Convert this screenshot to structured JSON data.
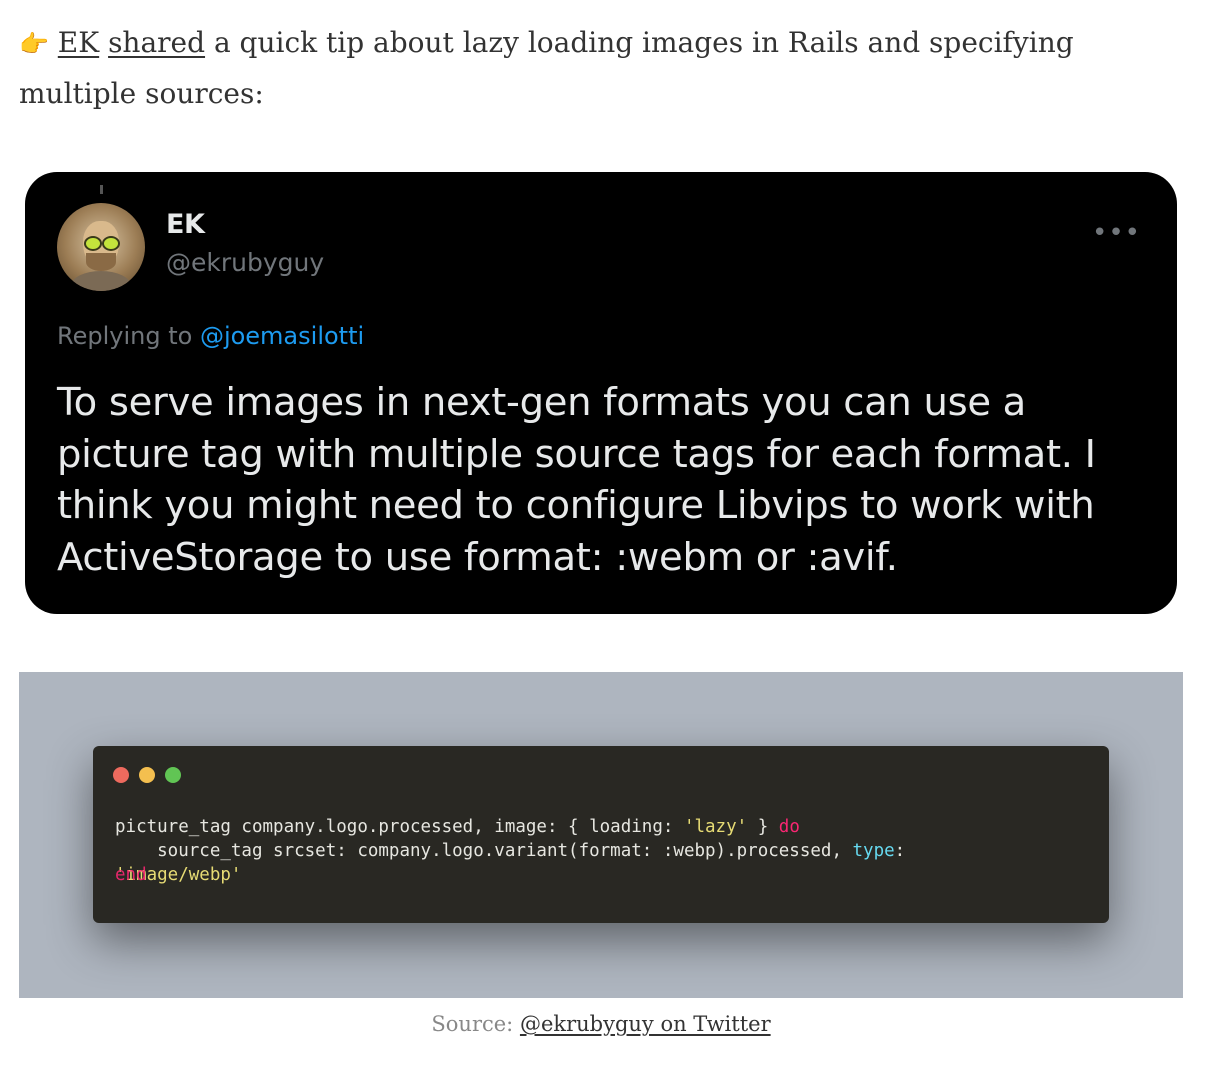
{
  "intro": {
    "emoji": "👉",
    "author_link": "EK",
    "shared_link": "shared",
    "text": " a quick tip about lazy loading images in Rails and specifying multiple sources:"
  },
  "tweet": {
    "name": "EK",
    "handle": "@ekrubyguy",
    "more": "•••",
    "replying_prefix": "Replying to ",
    "replying_mention": "@joemasilotti",
    "body": "To serve images in next-gen formats you can use a picture tag with multiple source tags for each format. I think you might need to configure Libvips to work with ActiveStorage to use format: :webm or :avif."
  },
  "code": {
    "line1_a": "picture_tag company.logo.processed, image: { loading: ",
    "line1_str": "'lazy'",
    "line1_b": " } ",
    "line1_kw": "do",
    "line2_a": "    source_tag srcset: company.logo.variant(format: :webp).processed, ",
    "line2_attr": "type",
    "line2_b": ":",
    "line3_str": "'image/webp'",
    "line3_end": "end"
  },
  "caption": {
    "prefix": "Source: ",
    "link": "@ekrubyguy on Twitter"
  }
}
